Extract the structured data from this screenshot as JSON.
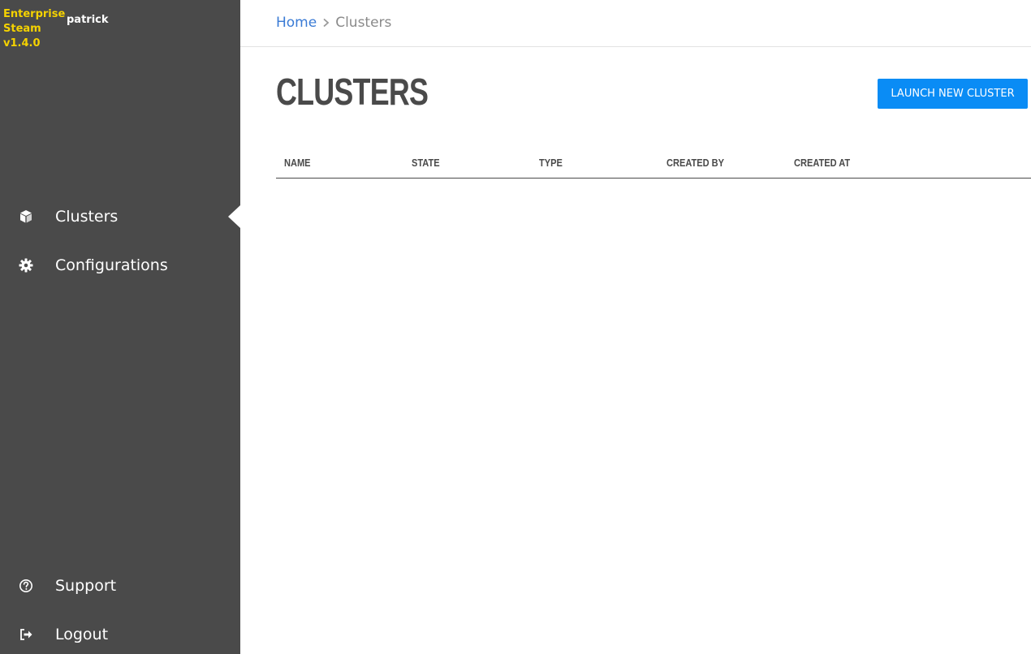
{
  "sidebar": {
    "brand_lines": [
      "Enterprise",
      "Steam",
      "v1.4.0"
    ],
    "username": "patrick",
    "nav": {
      "clusters": "Clusters",
      "configurations": "Configurations"
    },
    "footer": {
      "support": "Support",
      "logout": "Logout"
    }
  },
  "breadcrumb": {
    "home": "Home",
    "current": "Clusters"
  },
  "main": {
    "title": "CLUSTERS",
    "launch_button": "LAUNCH NEW CLUSTER",
    "table": {
      "columns": [
        "NAME",
        "STATE",
        "TYPE",
        "CREATED BY",
        "CREATED AT"
      ],
      "rows": []
    }
  },
  "colors": {
    "sidebar_bg": "#4a4a4a",
    "brand": "#f5d200",
    "accent": "#0a8cf5",
    "link": "#3a7bd5"
  },
  "icons": {
    "clusters": "cube-icon",
    "configurations": "gear-icon",
    "support": "question-circle-icon",
    "logout": "sign-out-icon",
    "breadcrumb_separator": "chevron-right-icon"
  }
}
